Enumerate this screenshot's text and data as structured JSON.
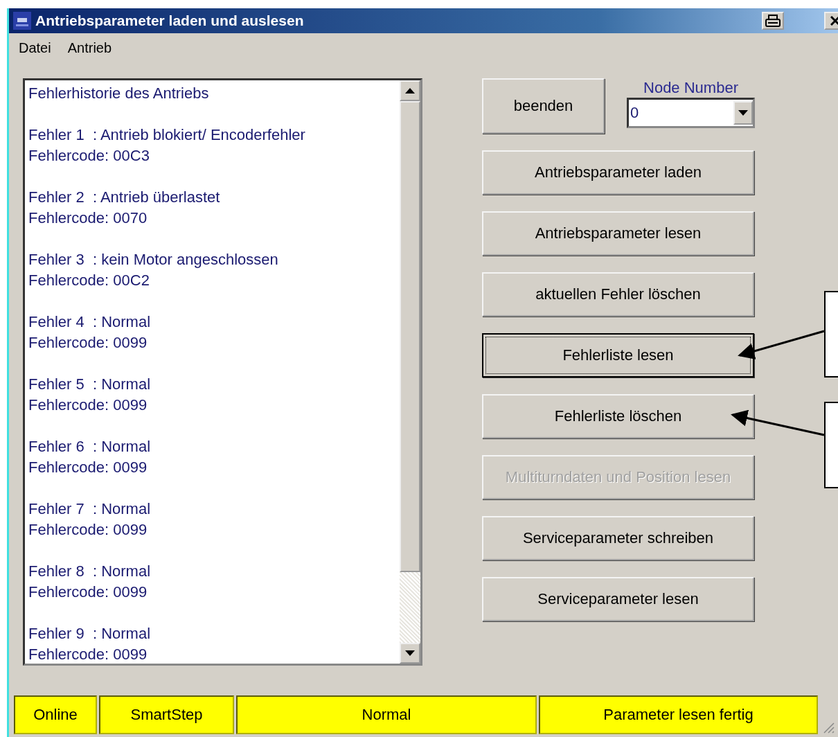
{
  "window": {
    "title": "Antriebsparameter laden und auslesen"
  },
  "menu": [
    "Datei",
    "Antrieb"
  ],
  "error_history": {
    "heading": "Fehlerhistorie des Antriebs",
    "entries": [
      {
        "label": "Fehler 1  : Antrieb blokiert/ Encoderfehler",
        "code": "Fehlercode: 00C3"
      },
      {
        "label": "Fehler 2  : Antrieb überlastet",
        "code": "Fehlercode: 0070"
      },
      {
        "label": "Fehler 3  : kein Motor angeschlossen",
        "code": "Fehlercode: 00C2"
      },
      {
        "label": "Fehler 4  : Normal",
        "code": "Fehlercode: 0099"
      },
      {
        "label": "Fehler 5  : Normal",
        "code": "Fehlercode: 0099"
      },
      {
        "label": "Fehler 6  : Normal",
        "code": "Fehlercode: 0099"
      },
      {
        "label": "Fehler 7  : Normal",
        "code": "Fehlercode: 0099"
      },
      {
        "label": "Fehler 8  : Normal",
        "code": "Fehlercode: 0099"
      },
      {
        "label": "Fehler 9  : Normal",
        "code": "Fehlercode: 0099"
      }
    ]
  },
  "close_button": {
    "label": "beenden"
  },
  "node_number": {
    "label": "Node Number",
    "value": "0"
  },
  "buttons": [
    {
      "label": "Antriebsparameter laden",
      "disabled": false,
      "focused": false
    },
    {
      "label": "Antriebsparameter lesen",
      "disabled": false,
      "focused": false
    },
    {
      "label": "aktuellen Fehler löschen",
      "disabled": false,
      "focused": false
    },
    {
      "label": "Fehlerliste lesen",
      "disabled": false,
      "focused": true
    },
    {
      "label": "Fehlerliste löschen",
      "disabled": false,
      "focused": false
    },
    {
      "label": "Multiturndaten und Position lesen",
      "disabled": true,
      "focused": false
    },
    {
      "label": "Serviceparameter schreiben",
      "disabled": false,
      "focused": false
    },
    {
      "label": "Serviceparameter lesen",
      "disabled": false,
      "focused": false
    }
  ],
  "status_bar": [
    "Online",
    "SmartStep",
    "Normal",
    "Parameter lesen fertig"
  ]
}
